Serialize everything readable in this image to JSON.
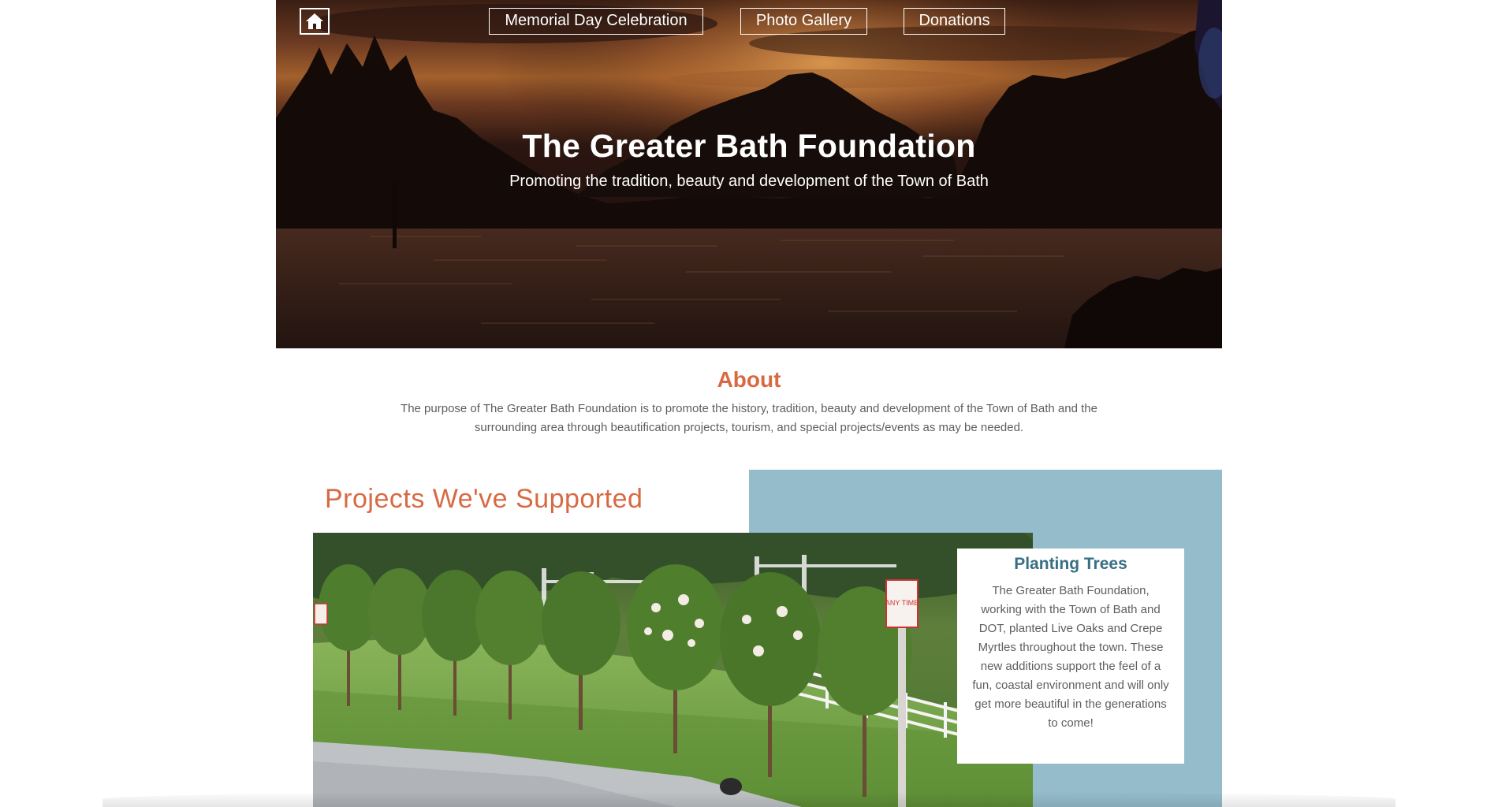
{
  "nav": {
    "home_icon": "home-icon",
    "items": [
      {
        "label": "Memorial Day Celebration"
      },
      {
        "label": "Photo Gallery"
      },
      {
        "label": "Donations"
      }
    ]
  },
  "hero": {
    "title": "The Greater Bath Foundation",
    "subtitle": "Promoting the tradition, beauty and development of the Town of Bath"
  },
  "about": {
    "heading": "About",
    "text": "The purpose of The Greater Bath Foundation is to promote the history, tradition, beauty and development of the Town of Bath and the surrounding area through beautification projects, tourism, and special projects/events as may be needed."
  },
  "projects": {
    "heading": "Projects We've Supported",
    "card": {
      "title": "Planting Trees",
      "text": "The Greater Bath Foundation, working with the Town of Bath and DOT, planted Live Oaks and Crepe Myrtles throughout the town. These new additions support the feel of a fun, coastal environment and will only get more beautiful in the generations to come!"
    },
    "sign_text": "ANY TIME"
  },
  "colors": {
    "accent": "#d86a43",
    "panel_blue": "#95bccb",
    "card_title": "#386f83",
    "body_text": "#5e5e5e"
  }
}
